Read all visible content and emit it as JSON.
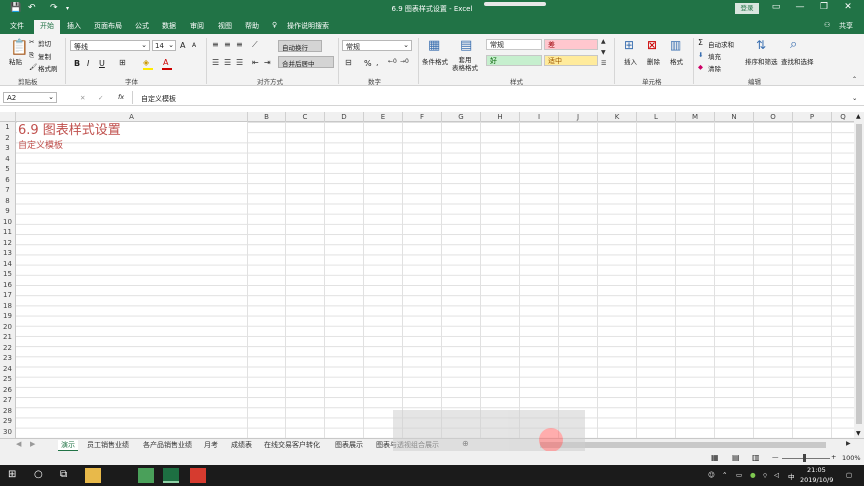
{
  "window": {
    "title": "6.9 图表样式设置 - Excel",
    "login": "登录",
    "share": "共享"
  },
  "tabs": [
    "文件",
    "开始",
    "插入",
    "页面布局",
    "公式",
    "数据",
    "审阅",
    "视图",
    "帮助",
    "操作说明搜索"
  ],
  "ribbon": {
    "clipboard": {
      "paste": "粘贴",
      "cut": "剪切",
      "copy": "复制",
      "format_painter": "格式刷",
      "label": "剪贴板"
    },
    "font": {
      "name": "等线",
      "size": "14",
      "label": "字体",
      "bold": "B",
      "italic": "I",
      "underline": "U",
      "grow": "A",
      "shrink": "A"
    },
    "alignment": {
      "wrap": "自动换行",
      "merge": "合并后居中",
      "label": "对齐方式"
    },
    "number": {
      "format": "常规",
      "percent": "%",
      "label": "数字"
    },
    "styles": {
      "cond": "条件格式",
      "table": "套用\n表格格式",
      "normal": "常规",
      "bad": "差",
      "good": "好",
      "neutral": "适中",
      "label": "样式"
    },
    "cells": {
      "insert": "插入",
      "delete": "删除",
      "format": "格式",
      "label": "单元格"
    },
    "editing": {
      "autosum": "自动求和",
      "fill": "填充",
      "clear": "清除",
      "sort": "排序和筛选",
      "find": "查找和选择",
      "label": "编辑"
    }
  },
  "formula": {
    "namebox": "A2",
    "fx": "fx",
    "content": "自定义模板"
  },
  "columns": [
    "A",
    "B",
    "C",
    "D",
    "E",
    "F",
    "G",
    "H",
    "I",
    "J",
    "K",
    "L",
    "M",
    "N",
    "O",
    "P",
    "Q"
  ],
  "rows": [
    "1",
    "2",
    "3",
    "4",
    "5",
    "6",
    "7",
    "8",
    "9",
    "10",
    "11",
    "12",
    "13",
    "14",
    "15",
    "16",
    "17",
    "18",
    "19",
    "20",
    "21",
    "22",
    "23",
    "24",
    "25",
    "26",
    "27",
    "28",
    "29",
    "30"
  ],
  "cells": {
    "a1": "6.9 图表样式设置",
    "a2": "自定义模板"
  },
  "sheets": [
    "演示",
    "员工销售业绩",
    "各产品销售业绩",
    "月考",
    "成绩表",
    "在线交易客户转化",
    "图表展示",
    "图表与透视组合展示"
  ],
  "status": {
    "zoom": "100%"
  },
  "taskbar": {
    "time": "21:05",
    "date": "2019/10/9",
    "ime": "中"
  },
  "colors": {
    "excel_green": "#217346",
    "title_red": "#c0504d",
    "bad_bg": "#ffc7ce",
    "good_bg": "#c6efce",
    "neutral_bg": "#ffeb9c"
  }
}
